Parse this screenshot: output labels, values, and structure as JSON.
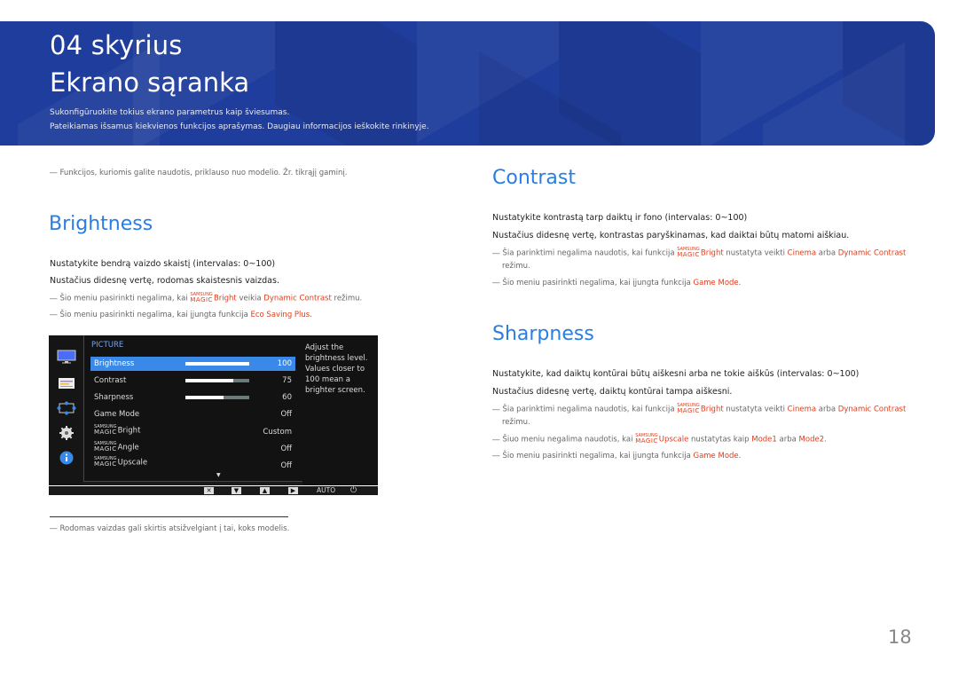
{
  "banner": {
    "chapter": "04 skyrius",
    "title": "Ekrano sąranka",
    "subtitle_1": "Sukonfigūruokite tokius ekrano parametrus kaip šviesumas.",
    "subtitle_2": "Pateikiamas išsamus kiekvienos funkcijos aprašymas. Daugiau informacijos ieškokite rinkinyje."
  },
  "left": {
    "top_note": "Funkcijos, kuriomis galite naudotis, priklauso nuo modelio. Žr. tikrąjį gaminį.",
    "brightness": {
      "heading": "Brightness",
      "line1": "Nustatykite bendrą vaizdo skaistį (intervalas: 0~100)",
      "line2": "Nustačius didesnę vertę, rodomas skaistesnis vaizdas.",
      "note1": {
        "pre": "Šio meniu pasirinkti negalima, kai ",
        "magic_small": "SAMSUNG",
        "magic_big": "MAGIC",
        "hl1": "Bright",
        "mid": " veikia ",
        "hl2": "Dynamic Contrast",
        "post": " režimu."
      },
      "note2": {
        "pre": "Šio meniu pasirinkti negalima, kai įjungta funkcija ",
        "hl1": "Eco Saving Plus",
        "post": "."
      }
    },
    "osd": {
      "category": "PICTURE",
      "rows": [
        {
          "label": "Brightness",
          "value": "100",
          "bar": 1.0
        },
        {
          "label": "Contrast",
          "value": "75",
          "bar": 0.75
        },
        {
          "label": "Sharpness",
          "value": "60",
          "bar": 0.6
        },
        {
          "label": "Game Mode",
          "value": "Off"
        },
        {
          "magic_small": "SAMSUNG",
          "magic_big": "MAGIC",
          "label": "Bright",
          "value": "Custom"
        },
        {
          "magic_small": "SAMSUNG",
          "magic_big": "MAGIC",
          "label": "Angle",
          "value": "Off"
        },
        {
          "magic_small": "SAMSUNG",
          "magic_big": "MAGIC",
          "label": "Upscale",
          "value": "Off"
        }
      ],
      "help": "Adjust the brightness level. Values closer to 100 mean a brighter screen.",
      "side_icons": [
        "monitor-icon",
        "color-icon",
        "size-position-icon",
        "gear-icon",
        "info-icon"
      ],
      "bottom": {
        "auto": "AUTO"
      },
      "colors": {
        "selected": "#3a88e8",
        "category": "#6ba7ff"
      }
    },
    "footnote": "Rodomas vaizdas gali skirtis atsižvelgiant į tai, koks modelis."
  },
  "right": {
    "contrast": {
      "heading": "Contrast",
      "line1": "Nustatykite kontrastą tarp daiktų ir fono (intervalas: 0~100)",
      "line2": "Nustačius didesnę vertę, kontrastas paryškinamas, kad daiktai būtų matomi aiškiau.",
      "note1": {
        "pre": "Šia parinktimi negalima naudotis, kai funkcija ",
        "magic_small": "SAMSUNG",
        "magic_big": "MAGIC",
        "hl1": "Bright",
        "mid": " nustatyta veikti ",
        "hl2": "Cinema",
        "mid2": " arba ",
        "hl3": "Dynamic Contrast",
        "post": "režimu."
      },
      "note2": {
        "pre": "Šio meniu pasirinkti negalima, kai įjungta funkcija ",
        "hl1": "Game Mode",
        "post": "."
      }
    },
    "sharpness": {
      "heading": "Sharpness",
      "line1": "Nustatykite, kad daiktų kontūrai būtų aiškesni arba ne tokie aiškūs (intervalas: 0~100)",
      "line2": "Nustačius didesnę vertę, daiktų kontūrai tampa aiškesni.",
      "note1": {
        "pre": "Šia parinktimi negalima naudotis, kai funkcija ",
        "magic_small": "SAMSUNG",
        "magic_big": "MAGIC",
        "hl1": "Bright",
        "mid": " nustatyta veikti ",
        "hl2": "Cinema",
        "mid2": " arba ",
        "hl3": "Dynamic Contrast",
        "post": "režimu."
      },
      "note2": {
        "pre": "Šiuo meniu negalima naudotis, kai ",
        "magic_small": "SAMSUNG",
        "magic_big": "MAGIC",
        "hl1": "Upscale",
        "mid": " nustatytas kaip ",
        "hl2": "Mode1",
        "mid2": " arba ",
        "hl3": "Mode2",
        "post": "."
      },
      "note3": {
        "pre": "Šio meniu pasirinkti negalima, kai įjungta funkcija ",
        "hl1": "Game Mode",
        "post": "."
      }
    }
  },
  "note_dash": "―",
  "page_number": "18",
  "colors": {
    "banner": "#1f3d9c",
    "heading": "#2a7de1",
    "highlight": "#e03c1a"
  }
}
